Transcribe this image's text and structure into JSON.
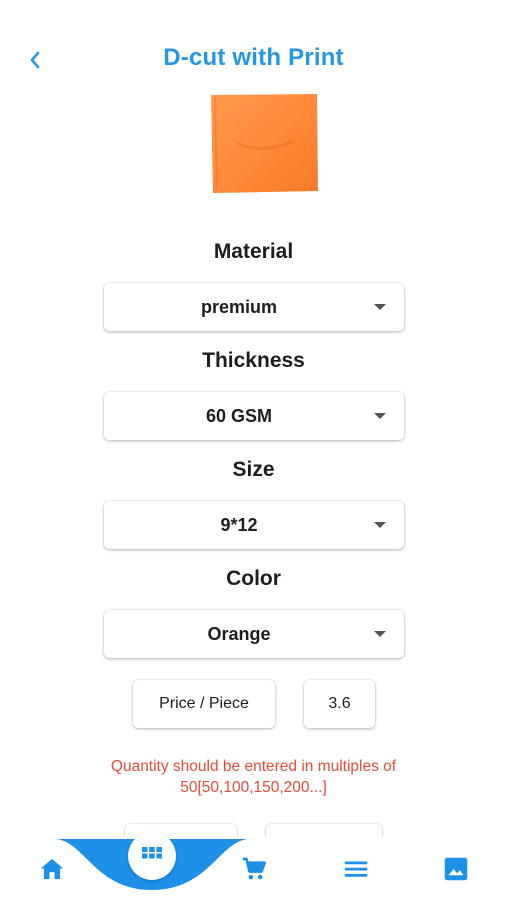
{
  "header": {
    "title": "D-cut with Print",
    "back_icon": "chevron-left-icon"
  },
  "product": {
    "image_color": "#ff8a3d"
  },
  "options": {
    "material": {
      "label": "Material",
      "value": "premium"
    },
    "thickness": {
      "label": "Thickness",
      "value": "60 GSM"
    },
    "size": {
      "label": "Size",
      "value": "9*12"
    },
    "color": {
      "label": "Color",
      "value": "Orange"
    }
  },
  "price": {
    "label": "Price / Piece",
    "value": "3.6"
  },
  "notice": "Quantity should be entered in multiples of 50[50,100,150,200...]",
  "bottom_nav": {
    "items": [
      "home-icon",
      "grid-icon",
      "cart-icon",
      "menu-icon",
      "image-icon"
    ],
    "accent": "#1e90e8"
  },
  "colors": {
    "accent": "#2596e8",
    "error": "#e74c3c"
  }
}
